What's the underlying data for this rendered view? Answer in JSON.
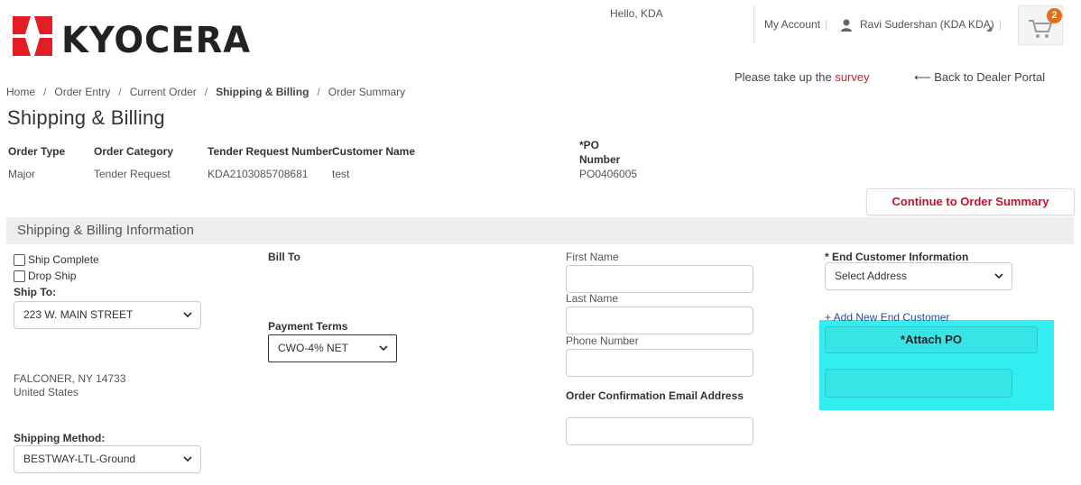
{
  "header": {
    "logo_text": "KYOCERA",
    "greeting": "Hello, KDA",
    "my_account": "My Account",
    "pipe": "|",
    "user_name": "Ravi Sudershan (KDA KDA)",
    "cart_count": "2",
    "survey_prefix": "Please take up the ",
    "survey_link": "survey",
    "back_link": "⟵ Back to Dealer Portal"
  },
  "breadcrumb": {
    "items": [
      "Home",
      "Order Entry",
      "Current Order",
      "Shipping & Billing",
      "Order Summary"
    ],
    "separator": "/"
  },
  "page_title": "Shipping & Billing",
  "order_info": {
    "headers": {
      "order_type": "Order Type",
      "order_category": "Order Category",
      "tender_request_number": "Tender Request Number",
      "customer_name": "Customer Name",
      "po_number_line1": "*PO",
      "po_number_line2": "Number"
    },
    "values": {
      "order_type": "Major",
      "order_category": "Tender Request",
      "tender_request_number": "KDA2103085708681",
      "customer_name": "test",
      "po_number": "PO0406005"
    }
  },
  "continue_button": "Continue to Order Summary",
  "section_title": "Shipping & Billing Information",
  "shipping": {
    "ship_complete_label": "Ship Complete",
    "drop_ship_label": "Drop Ship",
    "ship_to_label": "Ship To:",
    "ship_to_selected": "223 W. MAIN STREET",
    "address_city": "FALCONER, NY 14733",
    "address_country": "United States",
    "shipping_method_label": "Shipping Method:",
    "shipping_method_selected": "BESTWAY-LTL-Ground"
  },
  "billing": {
    "bill_to_label": "Bill To",
    "payment_terms_label": "Payment Terms",
    "payment_terms_selected": "CWO-4% NET"
  },
  "contact": {
    "first_name_label": "First Name",
    "last_name_label": "Last Name",
    "phone_label": "Phone Number",
    "email_label": "Order Confirmation Email Address"
  },
  "end_customer": {
    "label": "* End Customer Information",
    "select_placeholder": "Select Address",
    "add_link": "+ Add New End Customer",
    "attach_po": "*Attach PO"
  },
  "colors": {
    "brand_red": "#c8102e",
    "highlight_cyan": "#33eef0",
    "cart_badge": "#e36c1d"
  }
}
